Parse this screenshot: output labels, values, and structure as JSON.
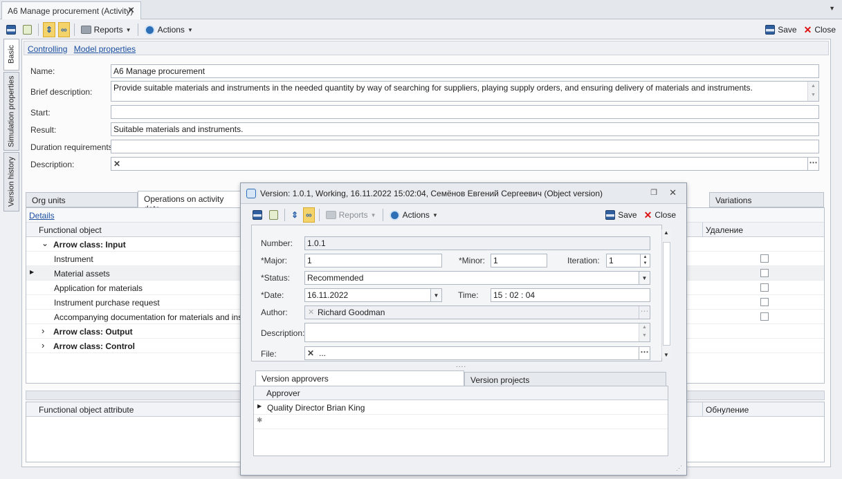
{
  "doc_tab": {
    "title": "A6 Manage procurement (Activity)",
    "close": "✕"
  },
  "tabstrip_menu": "▼",
  "toolbar": {
    "reports": "Reports",
    "actions": "Actions",
    "save": "Save",
    "close": "Close"
  },
  "side_tabs": [
    "Basic",
    "Simulation properties",
    "Version history"
  ],
  "links": {
    "controlling": "Controlling",
    "model_properties": "Model properties"
  },
  "form": {
    "name_label": "Name:",
    "name_value": "A6 Manage procurement",
    "brief_label": "Brief description:",
    "brief_value": "Provide suitable materials and instruments in the needed quantity by way of searching for suppliers, playing supply orders, and ensuring delivery of materials and instruments.",
    "start_label": "Start:",
    "start_value": "",
    "result_label": "Result:",
    "result_value": "Suitable materials and instruments.",
    "duration_label": "Duration requirements:",
    "duration_value": "",
    "description_label": "Description:",
    "description_value": ""
  },
  "lower_tabs": {
    "org_units": "Org units",
    "operations": "Operations on activity data",
    "variations": "Variations"
  },
  "details_link": "Details",
  "grid": {
    "col_object": "Functional object",
    "col_delete": "Удаление",
    "rows": [
      {
        "text": "Arrow class: Input",
        "group": true,
        "expander": "⌄"
      },
      {
        "text": "Instrument"
      },
      {
        "text": "Material assets",
        "current": true
      },
      {
        "text": "Application for materials"
      },
      {
        "text": "Instrument purchase request"
      },
      {
        "text": "Accompanying documentation for materials and instruments"
      },
      {
        "text": "Arrow class: Output",
        "group": true,
        "expander": "›"
      },
      {
        "text": "Arrow class: Control",
        "group": true,
        "expander": "›"
      }
    ]
  },
  "attr_grid": {
    "col_attribute": "Functional object attribute",
    "col_reset": "Обнуление"
  },
  "dialog": {
    "title": "Version: 1.0.1, Working, 16.11.2022 15:02:04, Семёнов Евгений Сергеевич (Object version)",
    "reports": "Reports",
    "actions": "Actions",
    "save": "Save",
    "close": "Close",
    "number_label": "Number:",
    "number_value": "1.0.1",
    "major_label": "*Major:",
    "major_value": "1",
    "minor_label": "*Minor:",
    "minor_value": "1",
    "iteration_label": "Iteration:",
    "iteration_value": "1",
    "status_label": "*Status:",
    "status_value": "Recommended",
    "date_label": "*Date:",
    "date_value": "16.11.2022",
    "time_label": "Time:",
    "time_value": "15 : 02 : 04",
    "author_label": "Author:",
    "author_value": "Richard Goodman",
    "description_label": "Description:",
    "description_value": "",
    "file_label": "File:",
    "file_value": "...",
    "tabs": {
      "approvers": "Version approvers",
      "projects": "Version projects"
    },
    "approver_col": "Approver",
    "approver_rows": [
      "Quality Director Brian King"
    ]
  }
}
